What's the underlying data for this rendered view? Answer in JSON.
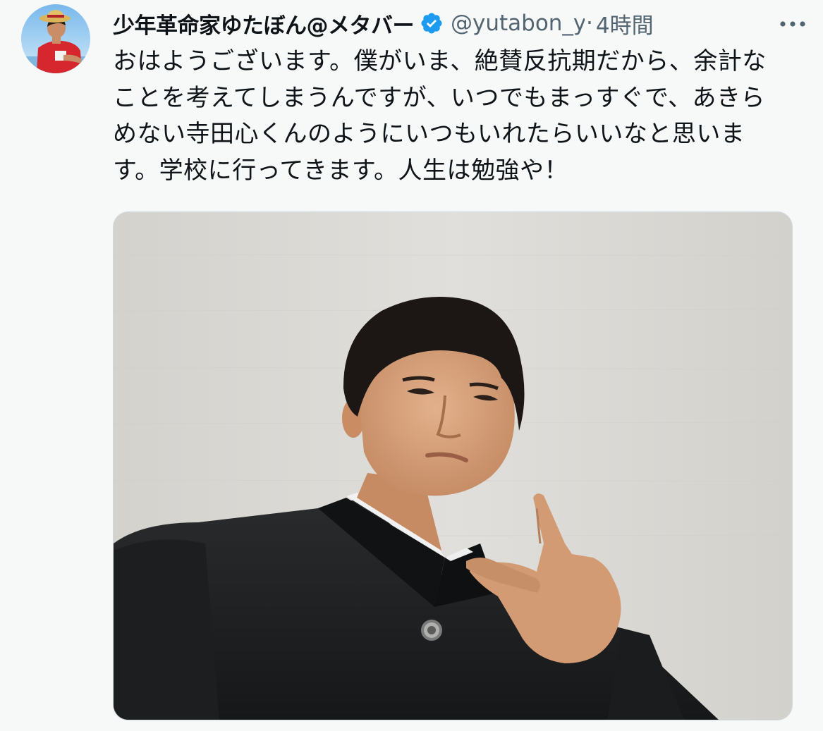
{
  "tweet": {
    "display_name": "少年革命家ゆたぼん@メタバー",
    "handle": "@yutabon_y",
    "separator": "·",
    "time": "4時間",
    "text": "おはようございます。僕がいま、絶賛反抗期だから、余計なことを考えてしまうんですが、いつでもまっすぐで、あきらめない寺田心くんのようにいつもいれたらいいなと思います。学校に行ってきます。人生は勉強や！",
    "verified": true,
    "icons": {
      "verified": "verified-badge-icon",
      "more": "more-dots-icon"
    },
    "colors": {
      "verified": "#1d9bf0",
      "text": "#0f1419",
      "secondary": "#536471",
      "background": "#f7f9f9"
    }
  }
}
